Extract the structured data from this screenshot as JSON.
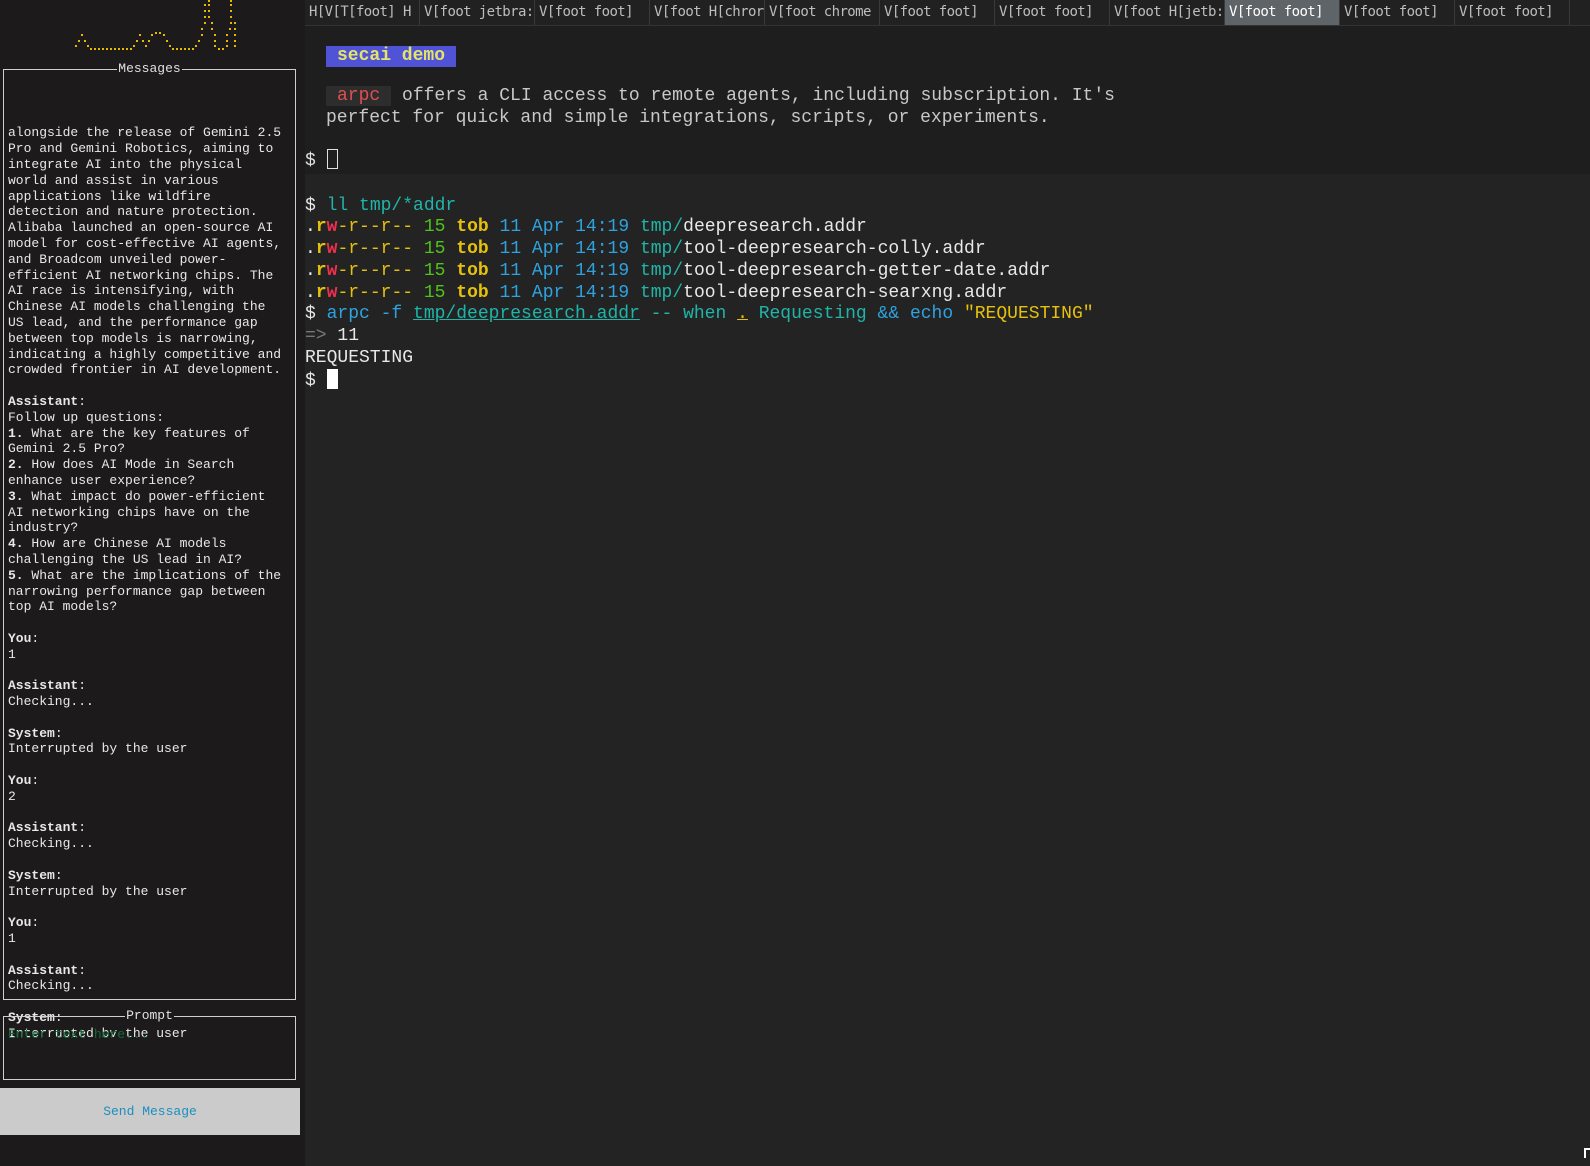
{
  "sidebar": {
    "messages_title": "Messages",
    "messages": [
      {
        "role": "",
        "lines": [
          "alongside the release of Gemini 2.5",
          "Pro and Gemini Robotics, aiming to",
          "integrate AI into the physical",
          "world and assist in various",
          "applications like wildfire",
          "detection and nature protection.",
          "Alibaba launched an open-source AI",
          "model for cost-effective AI agents,",
          "and Broadcom unveiled power-",
          "efficient AI networking chips. The",
          "AI race is intensifying, with",
          "Chinese AI models challenging the",
          "US lead, and the performance gap",
          "between top models is narrowing,",
          "indicating a highly competitive and",
          "crowded frontier in AI development."
        ]
      },
      {
        "role": "Assistant",
        "lines": [
          "Follow up questions:",
          "1. What are the key features of",
          "Gemini 2.5 Pro?",
          "2. How does AI Mode in Search",
          "enhance user experience?",
          "3. What impact do power-efficient",
          "AI networking chips have on the",
          "industry?",
          "4. How are Chinese AI models",
          "challenging the US lead in AI?",
          "5. What are the implications of the",
          "narrowing performance gap between",
          "top AI models?"
        ]
      },
      {
        "role": "You",
        "lines": [
          "1"
        ]
      },
      {
        "role": "Assistant",
        "lines": [
          "Checking..."
        ]
      },
      {
        "role": "System",
        "lines": [
          "Interrupted by the user"
        ]
      },
      {
        "role": "You",
        "lines": [
          "2"
        ]
      },
      {
        "role": "Assistant",
        "lines": [
          "Checking..."
        ]
      },
      {
        "role": "System",
        "lines": [
          "Interrupted by the user"
        ]
      },
      {
        "role": "You",
        "lines": [
          "1"
        ]
      },
      {
        "role": "Assistant",
        "lines": [
          "Checking..."
        ]
      },
      {
        "role": "System",
        "lines": [
          "Interrupted by the user"
        ]
      }
    ],
    "prompt_title": "Prompt",
    "prompt_placeholder": "Enter text here...",
    "prompt_value": "",
    "send_label": "Send Message"
  },
  "tabs": [
    {
      "label": "H[V[T[foot] H",
      "active": false
    },
    {
      "label": "V[foot jetbra:",
      "active": false
    },
    {
      "label": "V[foot foot]",
      "active": false
    },
    {
      "label": "V[foot H[chror",
      "active": false
    },
    {
      "label": "V[foot chrome",
      "active": false
    },
    {
      "label": "V[foot foot]",
      "active": false
    },
    {
      "label": "V[foot foot]",
      "active": false
    },
    {
      "label": "V[foot H[jetb:",
      "active": false
    },
    {
      "label": "V[foot foot]",
      "active": true
    },
    {
      "label": "V[foot foot]",
      "active": false
    },
    {
      "label": "V[foot foot]",
      "active": false
    }
  ],
  "terminal": {
    "badge": "secai demo",
    "desc_code": "arpc",
    "desc_line1": " offers a CLI access to remote agents, including subscription. It's",
    "desc_line2": "perfect for quick and simple integrations, scripts, or experiments.",
    "prompt": "$ ",
    "cmd1": "ll tmp/*addr",
    "files": [
      {
        "perm_dot": ".",
        "perm_r": "r",
        "perm_w": "w",
        "perm_rest": "-r--r--",
        "size": "15",
        "user": "tob",
        "date": "11 Apr 14:19",
        "dir": "tmp/",
        "name": "deepresearch.addr"
      },
      {
        "perm_dot": ".",
        "perm_r": "r",
        "perm_w": "w",
        "perm_rest": "-r--r--",
        "size": "15",
        "user": "tob",
        "date": "11 Apr 14:19",
        "dir": "tmp/",
        "name": "tool-deepresearch-colly.addr"
      },
      {
        "perm_dot": ".",
        "perm_r": "r",
        "perm_w": "w",
        "perm_rest": "-r--r--",
        "size": "15",
        "user": "tob",
        "date": "11 Apr 14:19",
        "dir": "tmp/",
        "name": "tool-deepresearch-getter-date.addr"
      },
      {
        "perm_dot": ".",
        "perm_r": "r",
        "perm_w": "w",
        "perm_rest": "-r--r--",
        "size": "15",
        "user": "tob",
        "date": "11 Apr 14:19",
        "dir": "tmp/",
        "name": "tool-deepresearch-searxng.addr"
      }
    ],
    "cmd2": {
      "a": "arpc -f ",
      "file": "tmp/deepresearch.addr",
      "b": " -- when ",
      "dot": ".",
      "c": " Requesting ",
      "amp": "&&",
      "echo": " echo ",
      "str": "\"REQUESTING\""
    },
    "result_arrow": "=>",
    "result_value": " 11",
    "echo_output": "REQUESTING"
  }
}
